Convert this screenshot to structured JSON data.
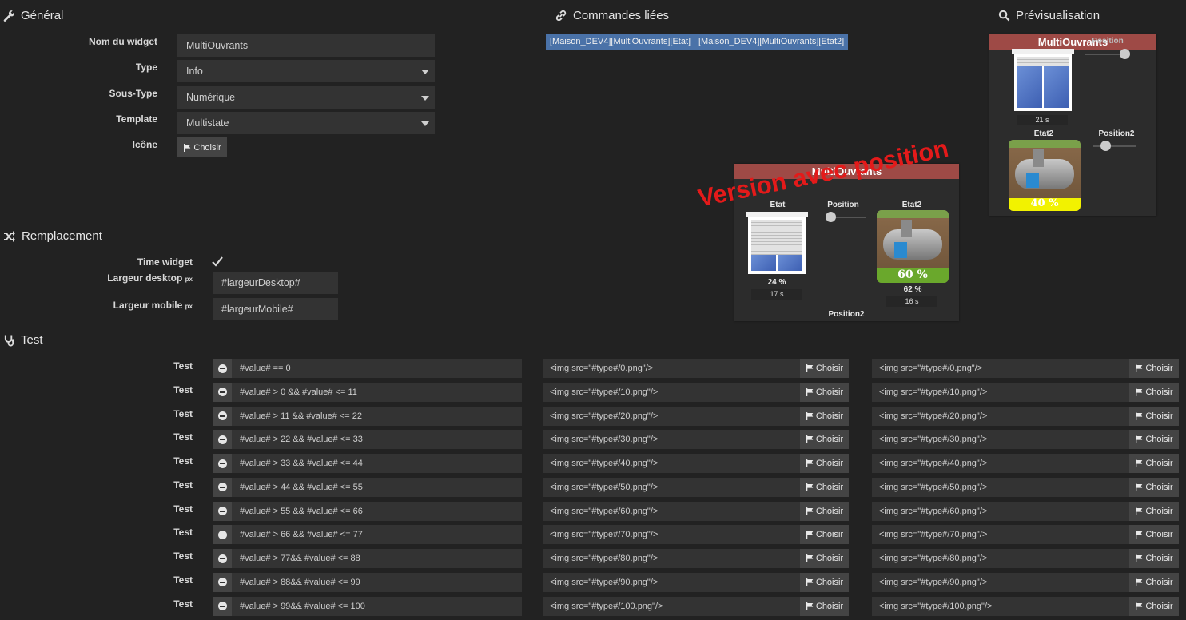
{
  "sections": {
    "general": "Général",
    "linked": "Commandes liées",
    "preview": "Prévisualisation",
    "replacement": "Remplacement",
    "test": "Test"
  },
  "general": {
    "name_label": "Nom du widget",
    "name_value": "MultiOuvrants",
    "type_label": "Type",
    "type_value": "Info",
    "subtype_label": "Sous-Type",
    "subtype_value": "Numérique",
    "template_label": "Template",
    "template_value": "Multistate",
    "icon_label": "Icône",
    "choose_label": "Choisir"
  },
  "linked_commands": [
    "[Maison_DEV4][MultiOuvrants][Etat]",
    "[Maison_DEV4][MultiOuvrants][Etat2]"
  ],
  "replacement": {
    "time_label": "Time widget",
    "desktop_label": "Largeur desktop",
    "mobile_label": "Largeur mobile",
    "px_unit": "px",
    "desktop_value": "#largeurDesktop#",
    "mobile_value": "#largeurMobile#"
  },
  "test_rows": [
    {
      "label": "Test",
      "condition": "#value# == 0",
      "img1": "<img src=\"#type#/0.png\"/>",
      "img2": "<img src=\"#type#/0.png\"/>",
      "btn": "Choisir"
    },
    {
      "label": "Test",
      "condition": "#value# > 0 && #value# <= 11",
      "img1": "<img src=\"#type#/10.png\"/>",
      "img2": "<img src=\"#type#/10.png\"/>",
      "btn": "Choisir"
    },
    {
      "label": "Test",
      "condition": "#value# > 11 && #value# <= 22",
      "img1": "<img src=\"#type#/20.png\"/>",
      "img2": "<img src=\"#type#/20.png\"/>",
      "btn": "Choisir"
    },
    {
      "label": "Test",
      "condition": "#value# > 22 && #value# <= 33",
      "img1": "<img src=\"#type#/30.png\"/>",
      "img2": "<img src=\"#type#/30.png\"/>",
      "btn": "Choisir"
    },
    {
      "label": "Test",
      "condition": "#value# > 33 && #value# <= 44",
      "img1": "<img src=\"#type#/40.png\"/>",
      "img2": "<img src=\"#type#/40.png\"/>",
      "btn": "Choisir"
    },
    {
      "label": "Test",
      "condition": "#value# > 44 && #value# <= 55",
      "img1": "<img src=\"#type#/50.png\"/>",
      "img2": "<img src=\"#type#/50.png\"/>",
      "btn": "Choisir"
    },
    {
      "label": "Test",
      "condition": "#value# > 55 && #value# <= 66",
      "img1": "<img src=\"#type#/60.png\"/>",
      "img2": "<img src=\"#type#/60.png\"/>",
      "btn": "Choisir"
    },
    {
      "label": "Test",
      "condition": "#value# > 66 && #value# <= 77",
      "img1": "<img src=\"#type#/70.png\"/>",
      "img2": "<img src=\"#type#/70.png\"/>",
      "btn": "Choisir"
    },
    {
      "label": "Test",
      "condition": "#value# > 77&& #value# <= 88",
      "img1": "<img src=\"#type#/80.png\"/>",
      "img2": "<img src=\"#type#/80.png\"/>",
      "btn": "Choisir"
    },
    {
      "label": "Test",
      "condition": "#value# > 88&& #value# <= 99",
      "img1": "<img src=\"#type#/90.png\"/>",
      "img2": "<img src=\"#type#/90.png\"/>",
      "btn": "Choisir"
    },
    {
      "label": "Test",
      "condition": "#value# > 99&& #value# <= 100",
      "img1": "<img src=\"#type#/100.png\"/>",
      "img2": "<img src=\"#type#/100.png\"/>",
      "btn": "Choisir"
    }
  ],
  "widget_demo": {
    "title": "MultiOuvrants",
    "etat_label": "Etat",
    "position_label": "Position",
    "etat2_label": "Etat2",
    "position2_label": "Position2",
    "etat_pct": "24 %",
    "etat_time": "17 s",
    "etat2_big": "60 %",
    "etat2_pct": "62 %",
    "etat2_time": "16 s",
    "watermark": "Version avec position"
  },
  "preview_widget": {
    "title": "MultiOuvrants",
    "position_label": "Position",
    "time": "21 s",
    "etat2_label": "Etat2",
    "position2_label": "Position2",
    "tank_pct": "40 %"
  },
  "colors": {
    "background": "#222222",
    "field": "#333333",
    "tag_blue": "#4a72a8",
    "widget_header": "#9e4a46",
    "watermark_red": "#e41a1a",
    "tank_green": "#6aa82c",
    "tank_yellow": "#f2f200"
  }
}
